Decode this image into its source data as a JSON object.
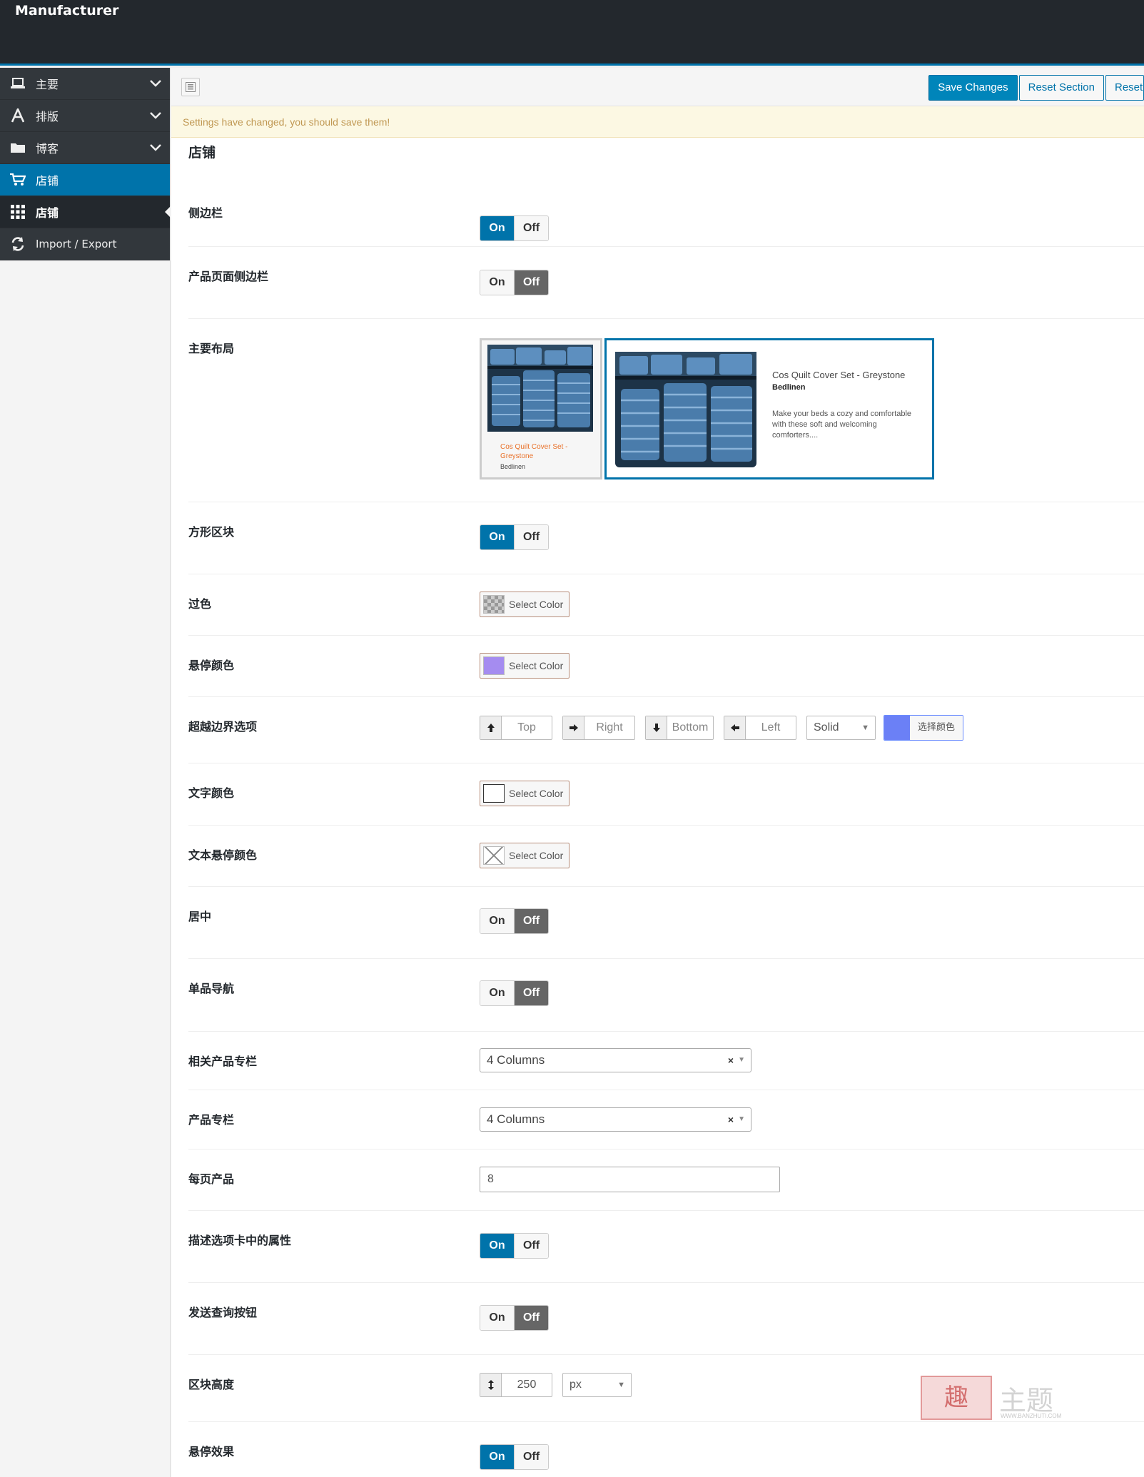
{
  "app": {
    "title": "Manufacturer"
  },
  "sidebar": {
    "items": [
      {
        "label": "主要",
        "icon": "laptop-icon"
      },
      {
        "label": "排版",
        "icon": "font-icon"
      },
      {
        "label": "博客",
        "icon": "folder-icon"
      },
      {
        "label": "店铺",
        "icon": "cart-icon"
      },
      {
        "label": "店铺",
        "icon": "grid-icon"
      },
      {
        "label": "Import / Export",
        "icon": "refresh-icon"
      }
    ]
  },
  "toolbar": {
    "save_label": "Save Changes",
    "reset_section_label": "Reset Section",
    "reset_all_label": "Reset"
  },
  "notice": "Settings have changed, you should save them!",
  "section": {
    "title": "店铺"
  },
  "toggle": {
    "on": "On",
    "off": "Off"
  },
  "colors": {
    "accent": "#0073aa",
    "header_bg": "#23282d",
    "hover_swatch": "#a58cf0",
    "border_swatch": "#6b80f6",
    "off_active": "#666666"
  },
  "fields": {
    "sidebar": {
      "label": "侧边栏",
      "value": "On"
    },
    "product_sidebar": {
      "label": "产品页面侧边栏",
      "value": "Off"
    },
    "layout": {
      "label": "主要布局",
      "option1": {
        "title": "Cos Quilt Cover Set - Greystone",
        "category": "Bedlinen"
      },
      "option2": {
        "title": "Cos Quilt Cover Set - Greystone",
        "category": "Bedlinen",
        "desc": "Make your beds a cozy and comfortable with these soft and welcoming comforters...."
      }
    },
    "square_block": {
      "label": "方形区块",
      "value": "On"
    },
    "overlay": {
      "label": "过色",
      "button": "Select Color"
    },
    "hover_color": {
      "label": "悬停颜色",
      "button": "Select Color"
    },
    "border": {
      "label": "超越边界选项",
      "top": "Top",
      "right": "Right",
      "bottom": "Bottom",
      "left": "Left",
      "style": "Solid",
      "color_button": "选择颜色"
    },
    "text_color": {
      "label": "文字颜色",
      "button": "Select Color"
    },
    "text_hover_color": {
      "label": "文本悬停颜色",
      "button": "Select Color"
    },
    "center": {
      "label": "居中",
      "value": "Off"
    },
    "single_nav": {
      "label": "单品导航",
      "value": "Off"
    },
    "related_columns": {
      "label": "相关产品专栏",
      "value": "4 Columns"
    },
    "product_columns": {
      "label": "产品专栏",
      "value": "4 Columns"
    },
    "per_page": {
      "label": "每页产品",
      "value": "8"
    },
    "desc_attr": {
      "label": "描述选项卡中的属性",
      "value": "On"
    },
    "enquiry_btn": {
      "label": "发送查询按钮",
      "value": "Off"
    },
    "block_height": {
      "label": "区块高度",
      "value": "250",
      "unit": "px"
    },
    "hover_effect": {
      "label": "悬停效果",
      "value": "On"
    }
  },
  "watermark": {
    "logo_char": "趣",
    "text": "主题",
    "url": "WWW.BANZHUTI.COM"
  }
}
